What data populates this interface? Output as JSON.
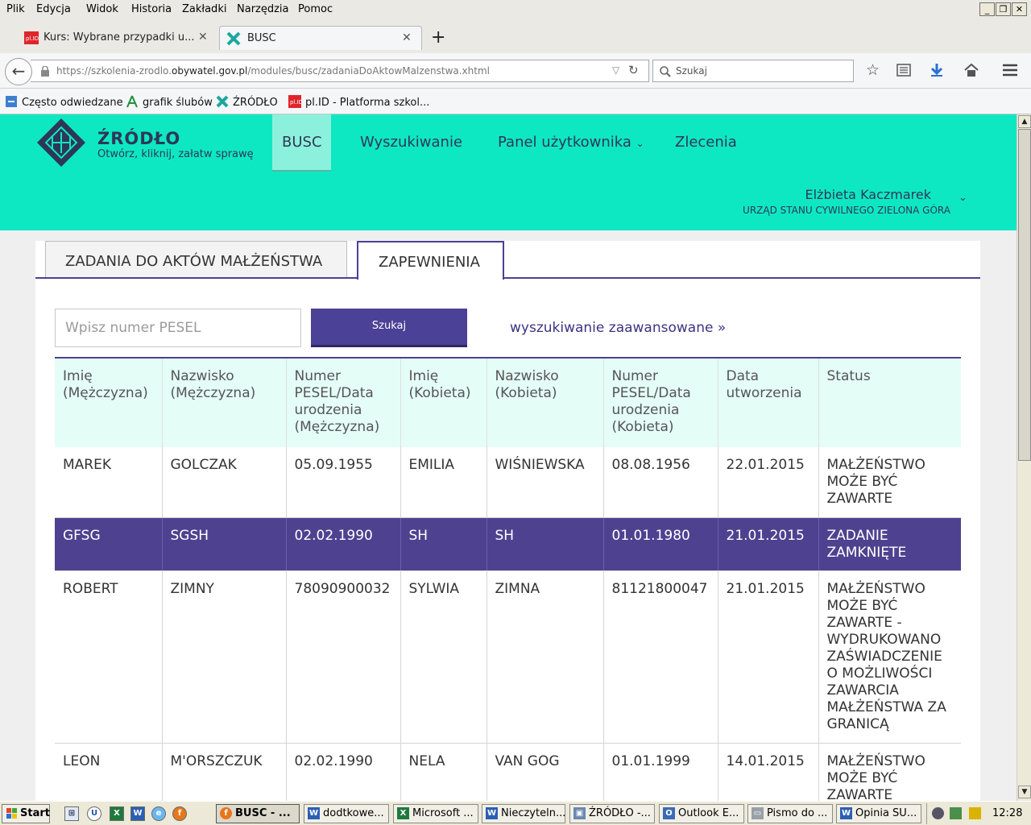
{
  "menubar": {
    "items": [
      "Plik",
      "Edycja",
      "Widok",
      "Historia",
      "Zakładki",
      "Narzędzia",
      "Pomoc"
    ]
  },
  "tabs": [
    {
      "label": "Kurs: Wybrane przypadki u...",
      "icon": "plid-icon",
      "active": false
    },
    {
      "label": "BUSC",
      "icon": "zrodlo-icon",
      "active": true
    }
  ],
  "navbar": {
    "url_prefix": "https://szkolenia-zrodlo.",
    "url_domain": "obywatel.gov.pl",
    "url_path": "/modules/busc/zadaniaDoAktowMalzenstwa.xhtml",
    "search_placeholder": "Szukaj"
  },
  "bookmarks": [
    {
      "label": "Często odwiedzane",
      "icon": "frequent-icon"
    },
    {
      "label": "grafik ślubów",
      "icon": "grafik-icon"
    },
    {
      "label": "ŹRÓDŁO",
      "icon": "zrodlo-icon"
    },
    {
      "label": "pl.ID - Platforma szkol...",
      "icon": "plid-icon"
    }
  ],
  "site": {
    "brand": "ŹRÓDŁO",
    "tagline": "Otwórz, kliknij, załatw sprawę",
    "nav": {
      "busc": "BUSC",
      "search": "Wyszukiwanie",
      "panel": "Panel użytkownika",
      "orders": "Zlecenia"
    },
    "user": {
      "name": "Elżbieta Kaczmarek",
      "office": "URZĄD STANU CYWILNEGO ZIELONA GÓRA"
    },
    "colors": {
      "header": "#0ee8c2",
      "accent": "#4b4196",
      "text": "#2e3758"
    }
  },
  "page": {
    "tabs": [
      "ZADANIA DO AKTÓW MAŁŻEŃSTWA",
      "ZAPEWNIENIA"
    ],
    "active_tab": "ZAPEWNIENIA",
    "search": {
      "placeholder": "Wpisz numer PESEL",
      "button": "Szukaj",
      "advanced_link": "wyszukiwanie zaawansowane »"
    },
    "table": {
      "headers": [
        "Imię (Mężczyzna)",
        "Nazwisko (Mężczyzna)",
        "Numer PESEL/Data urodzenia (Mężczyzna)",
        "Imię (Kobieta)",
        "Nazwisko (Kobieta)",
        "Numer PESEL/Data urodzenia (Kobieta)",
        "Data utworzenia",
        "Status"
      ],
      "rows": [
        [
          "MAREK",
          "GOLCZAK",
          "05.09.1955",
          "EMILIA",
          "WIŚNIEWSKA",
          "08.08.1956",
          "22.01.2015",
          "MAŁŻEŃSTWO MOŻE BYĆ ZAWARTE"
        ],
        [
          "GFSG",
          "SGSH",
          "02.02.1990",
          "SH",
          "SH",
          "01.01.1980",
          "21.01.2015",
          "ZADANIE ZAMKNIĘTE"
        ],
        [
          "ROBERT",
          "ZIMNY",
          "78090900032",
          "SYLWIA",
          "ZIMNA",
          "81121800047",
          "21.01.2015",
          "MAŁŻEŃSTWO MOŻE BYĆ ZAWARTE - WYDRUKOWANO ZAŚWIADCZENIE O MOŻLIWOŚCI ZAWARCIA MAŁŻEŃSTWA ZA GRANICĄ"
        ],
        [
          "LEON",
          "M'ORSZCZUK",
          "02.02.1990",
          "NELA",
          "VAN GOG",
          "01.01.1999",
          "14.01.2015",
          "MAŁŻEŃSTWO MOŻE BYĆ ZAWARTE"
        ]
      ],
      "selected_row": 1
    }
  },
  "taskbar": {
    "start": "Start",
    "tasks": [
      {
        "label": "BUSC - ...",
        "icon": "firefox-icon",
        "active": true
      },
      {
        "label": "dodtkowe...",
        "icon": "word-icon",
        "active": false
      },
      {
        "label": "Microsoft ...",
        "icon": "excel-icon",
        "active": false
      },
      {
        "label": "Nieczyteln...",
        "icon": "word-icon",
        "active": false
      },
      {
        "label": "ŹRÓDŁO -...",
        "icon": "app-icon",
        "active": false
      },
      {
        "label": "Outlook E...",
        "icon": "outlook-icon",
        "active": false
      },
      {
        "label": "Pismo do ...",
        "icon": "window-icon",
        "active": false
      },
      {
        "label": "Opinia SU...",
        "icon": "word-icon",
        "active": false
      }
    ],
    "clock": "12:28"
  }
}
